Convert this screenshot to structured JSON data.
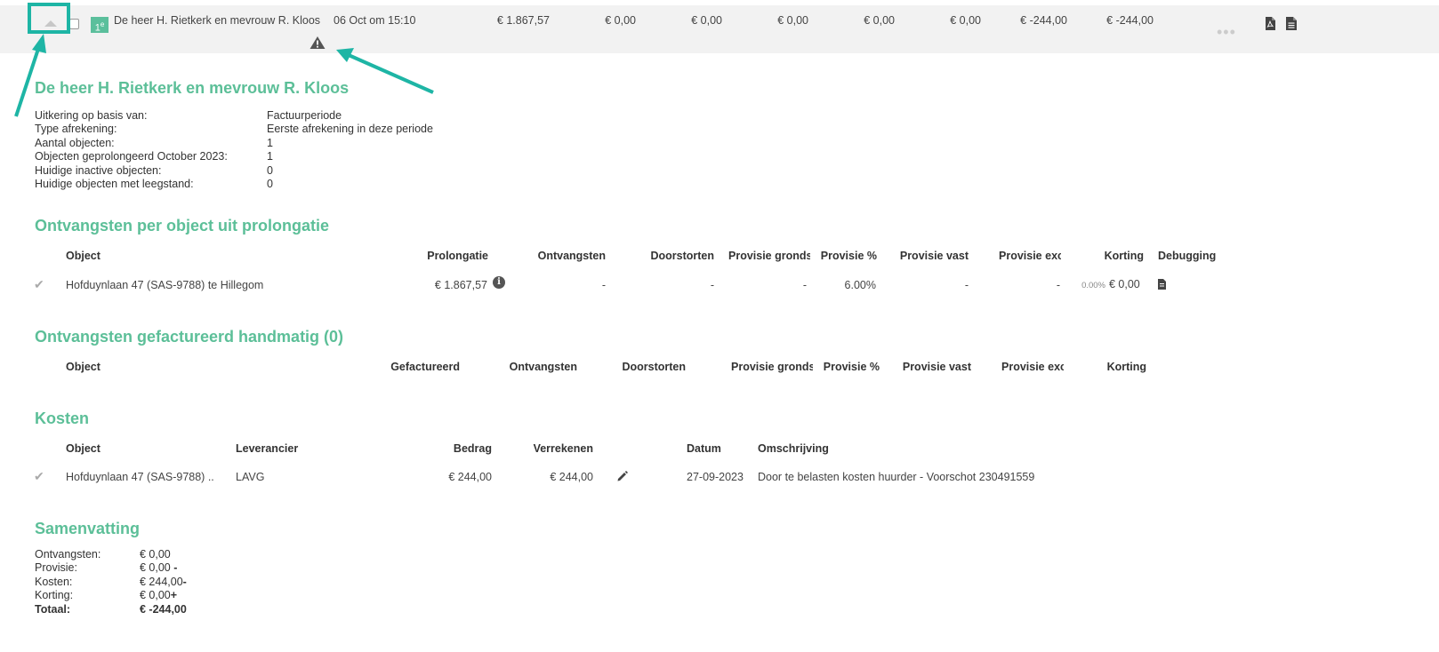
{
  "colors": {
    "accent": "#5cbf98",
    "highlight": "#1eb5a5",
    "row_bg": "#f2f2f2"
  },
  "row": {
    "badge": "1",
    "badge_sup": "e",
    "name": "De heer H. Rietkerk en mevrouw R. Kloos",
    "date": "06 Oct om 15:10",
    "amounts": [
      "€ 1.867,57",
      "€ 0,00",
      "€ 0,00",
      "€ 0,00",
      "€ 0,00",
      "€ 0,00",
      "€ -244,00",
      "€ -244,00"
    ],
    "more": "•••",
    "icons": [
      "collapse-caret-icon",
      "warning-icon",
      "pdf-icon",
      "document-icon"
    ]
  },
  "details": {
    "title": "De heer H. Rietkerk en mevrouw R. Kloos",
    "rows": [
      {
        "label": "Uitkering op basis van:",
        "value": "Factuurperiode"
      },
      {
        "label": "Type afrekening:",
        "value": "Eerste afrekening in deze periode"
      },
      {
        "label": "Aantal objecten:",
        "value": "1"
      },
      {
        "label": "Objecten geprolongeerd October 2023:",
        "value": "1"
      },
      {
        "label": "Huidige inactive objecten:",
        "value": "0"
      },
      {
        "label": "Huidige objecten met leegstand:",
        "value": "0"
      }
    ]
  },
  "prolongatie": {
    "title": "Ontvangsten per object uit prolongatie",
    "headers": [
      "Object",
      "Prolongatie",
      "Ontvangsten",
      "Doorstorten",
      "Provisie grondsla",
      "Provisie %",
      "Provisie vast",
      "Provisie excl",
      "Korting",
      "Debugging"
    ],
    "row": {
      "object": "Hofduynlaan 47 (SAS-9788) te Hillegom",
      "prolongatie": "€ 1.867,57",
      "info": "i",
      "ontvangsten": "-",
      "doorstorten": "-",
      "grondslag": "-",
      "provisie_pct": "6.00%",
      "provisie_vast": "-",
      "provisie_excl": "-",
      "korting_pct": "0.00%",
      "korting": "€ 0,00"
    }
  },
  "handmatig": {
    "title": "Ontvangsten gefactureerd handmatig (0)",
    "headers": [
      "Object",
      "Gefactureerd",
      "Ontvangsten",
      "Doorstorten",
      "Provisie grondsla",
      "Provisie %",
      "Provisie vast",
      "Provisie excl",
      "Korting"
    ]
  },
  "kosten": {
    "title": "Kosten",
    "headers": [
      "Object",
      "Leverancier",
      "Bedrag",
      "Verrekenen",
      "Datum",
      "Omschrijving"
    ],
    "row": {
      "object": "Hofduynlaan 47 (SAS-9788) ..",
      "leverancier": "LAVG",
      "bedrag": "€ 244,00",
      "verrekenen": "€ 244,00",
      "datum": "27-09-2023",
      "omschrijving": "Door te belasten kosten huurder - Voorschot 230491559"
    }
  },
  "samenvatting": {
    "title": "Samenvatting",
    "rows": [
      {
        "label": "Ontvangsten:",
        "value": "€ 0,00",
        "sign": ""
      },
      {
        "label": "Provisie:",
        "value": "€ 0,00",
        "sign": " -"
      },
      {
        "label": "Kosten:",
        "value": "€ 244,00",
        "sign": "-"
      },
      {
        "label": "Korting:",
        "value": "€ 0,00",
        "sign": "+"
      },
      {
        "label": "Totaal:",
        "value": "€ -244,00",
        "sign": ""
      }
    ]
  }
}
